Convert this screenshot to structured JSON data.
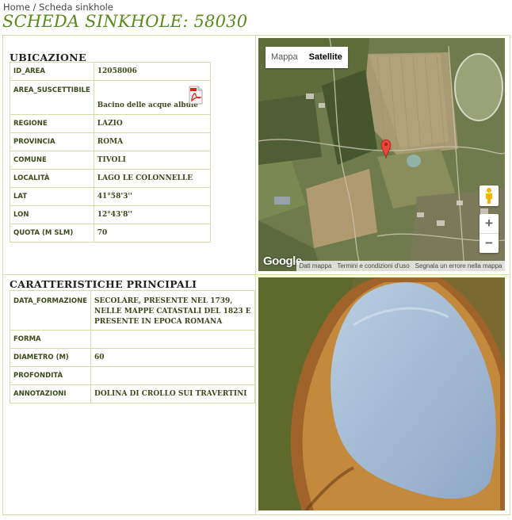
{
  "breadcrumb": {
    "home": "Home",
    "separator": " / ",
    "current": "Scheda sinkhole"
  },
  "page_title": "SCHEDA SINKHOLE: 58030",
  "ubicazione": {
    "title": "UBICAZIONE",
    "rows": [
      {
        "label": "ID_AREA",
        "value": "12058006"
      },
      {
        "label": "AREA_SUSCETTIBILE",
        "value": "Bacino delle acque albule",
        "icon": "pdf-icon"
      },
      {
        "label": "REGIONE",
        "value": "LAZIO"
      },
      {
        "label": "PROVINCIA",
        "value": "ROMA"
      },
      {
        "label": "COMUNE",
        "value": "TIVOLI"
      },
      {
        "label": "LOCALITÀ",
        "value": "LAGO LE COLONNELLE"
      },
      {
        "label": "LAT",
        "value": "41°58'3''"
      },
      {
        "label": "LON",
        "value": "12°43'8''"
      },
      {
        "label": "QUOTA (M SLM)",
        "value": "70"
      }
    ]
  },
  "caratteristiche": {
    "title": "CARATTERISTICHE PRINCIPALI",
    "rows": [
      {
        "label": "DATA_FORMAZIONE",
        "value": "SECOLARE, PRESENTE NEL 1739, NELLE MAPPE CATASTALI DEL 1823 E PRESENTE IN EPOCA ROMANA"
      },
      {
        "label": "FORMA",
        "value": ""
      },
      {
        "label": "DIAMETRO (M)",
        "value": "60"
      },
      {
        "label": "PROFONDITÀ",
        "value": ""
      },
      {
        "label": "ANNOTAZIONI",
        "value": "DOLINA DI CROLLO SUI TRAVERTINI"
      }
    ]
  },
  "map": {
    "type_mappa": "Mappa",
    "type_satellite": "Satellite",
    "zoom_in": "+",
    "zoom_out": "−",
    "logo": "Google",
    "attrib_data": "Dati mappa",
    "attrib_terms": "Termini e condizioni d'uso",
    "attrib_report": "Segnala un errore nella mappa"
  },
  "colors": {
    "accent": "#5a8a1a",
    "border": "#cfe0a8",
    "label": "#3b4a1a"
  }
}
